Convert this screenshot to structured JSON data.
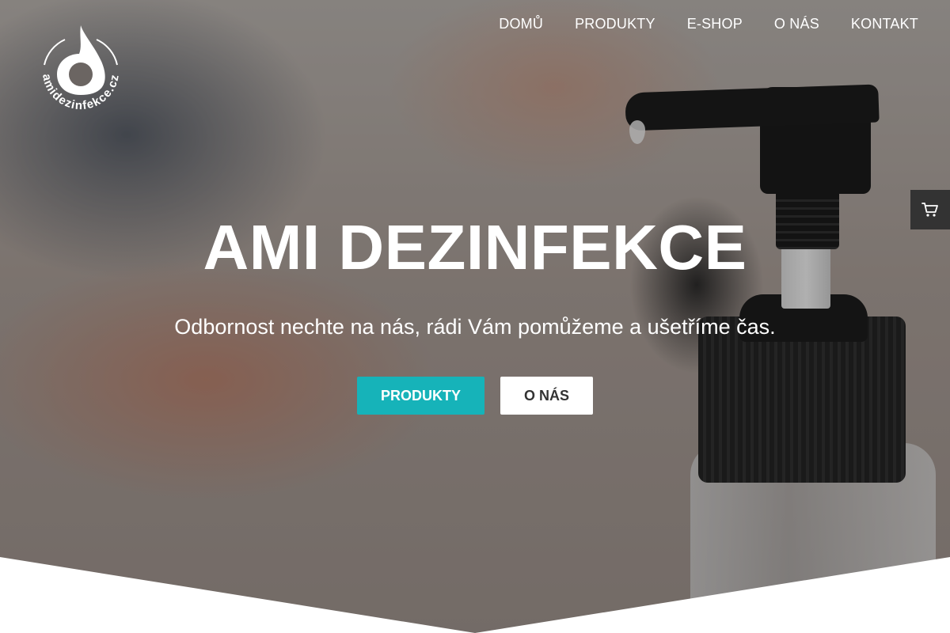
{
  "brand": {
    "logo_text": "amidezinfekce.cz",
    "accent_color": "#16b3b9"
  },
  "nav": {
    "items": [
      {
        "label": "DOMŮ"
      },
      {
        "label": "PRODUKTY"
      },
      {
        "label": "E-SHOP"
      },
      {
        "label": "O NÁS"
      },
      {
        "label": "KONTAKT"
      }
    ]
  },
  "cart": {
    "icon": "cart-icon"
  },
  "hero": {
    "title": "AMI DEZINFEKCE",
    "subtitle": "Odbornost nechte na nás, rádi Vám pomůžeme a ušetříme čas.",
    "primary_button": "PRODUKTY",
    "secondary_button": "O NÁS"
  }
}
